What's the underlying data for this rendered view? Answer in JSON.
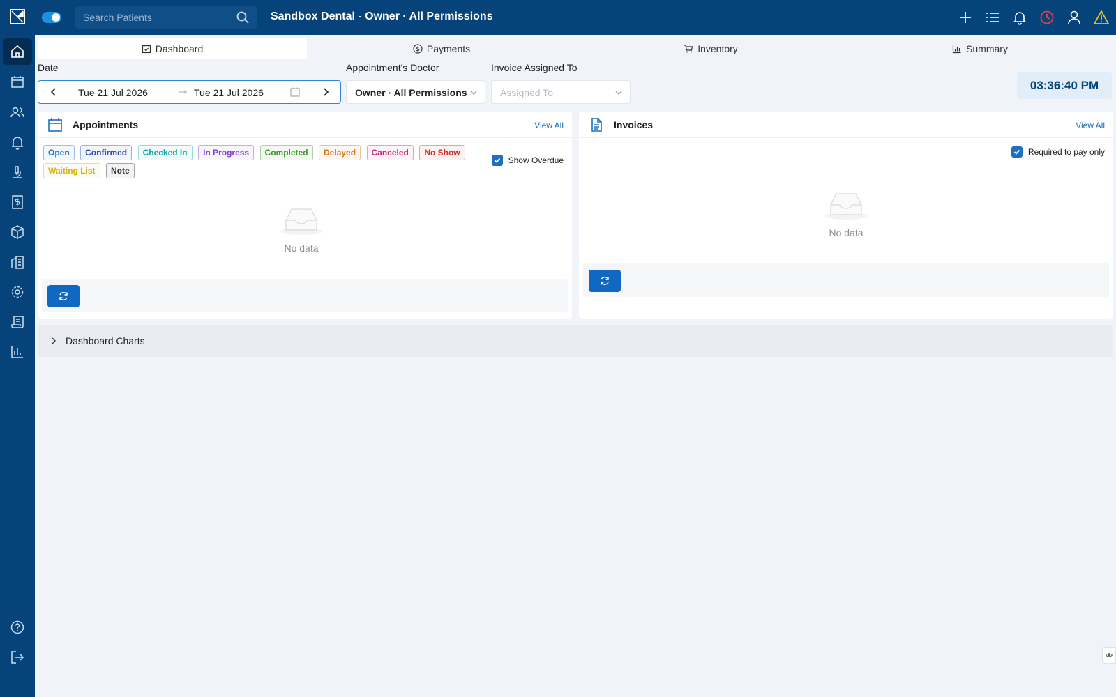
{
  "header": {
    "search_placeholder": "Search Patients",
    "title": "Sandbox Dental - Owner · All Permissions"
  },
  "tabs": [
    {
      "label": "Dashboard",
      "icon": "calendar-check-icon",
      "active": true
    },
    {
      "label": "Payments",
      "icon": "dollar-circle-icon",
      "active": false
    },
    {
      "label": "Inventory",
      "icon": "cart-icon",
      "active": false
    },
    {
      "label": "Summary",
      "icon": "bar-chart-icon",
      "active": false
    }
  ],
  "filters": {
    "date_label": "Date",
    "date_from": "Tue 21 Jul 2026",
    "date_to": "Tue 21 Jul 2026",
    "doctor_label": "Appointment's Doctor",
    "doctor_value": "Owner · All Permissions",
    "invoice_label": "Invoice Assigned To",
    "invoice_placeholder": "Assigned To"
  },
  "clock": "03:36:40 PM",
  "appointments": {
    "title": "Appointments",
    "view_all": "View All",
    "statuses": [
      {
        "label": "Open",
        "color": "#1e6fc0"
      },
      {
        "label": "Confirmed",
        "color": "#2a4fb0"
      },
      {
        "label": "Checked In",
        "color": "#13a8a8"
      },
      {
        "label": "In Progress",
        "color": "#7a3fc8"
      },
      {
        "label": "Completed",
        "color": "#3a9a2a"
      },
      {
        "label": "Delayed",
        "color": "#d4780a"
      },
      {
        "label": "Canceled",
        "color": "#c4287a"
      },
      {
        "label": "No Show",
        "color": "#d42a2a"
      },
      {
        "label": "Waiting List",
        "color": "#d4b40a"
      },
      {
        "label": "Note",
        "color": "#333333"
      }
    ],
    "show_overdue_label": "Show Overdue",
    "show_overdue_checked": true,
    "empty_text": "No data"
  },
  "invoices": {
    "title": "Invoices",
    "view_all": "View All",
    "required_label": "Required to pay only",
    "required_checked": true,
    "empty_text": "No data"
  },
  "dashboard_charts": {
    "label": "Dashboard Charts",
    "expanded": false
  },
  "colors": {
    "nav_bg": "#05437a",
    "accent": "#1068c2",
    "page_bg": "#f0f3f8",
    "clock_bg": "#e1edf8"
  }
}
